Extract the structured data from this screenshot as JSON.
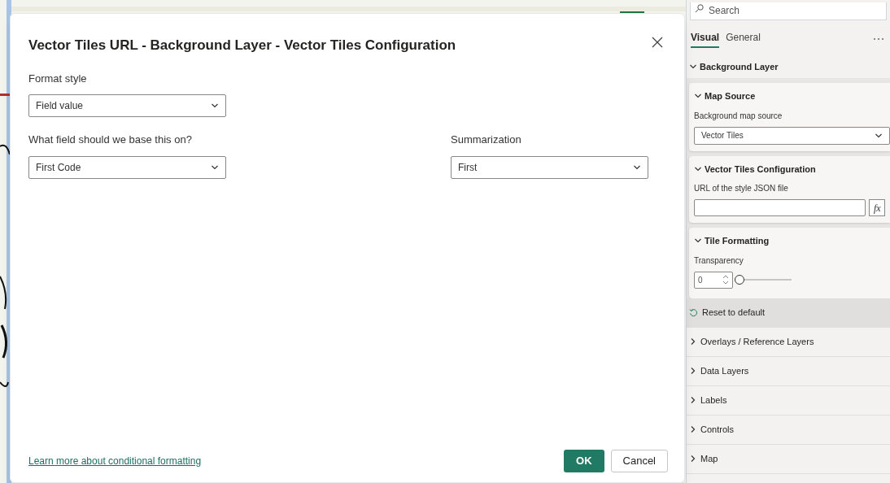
{
  "dialog": {
    "title": "Vector Tiles URL - Background Layer - Vector Tiles Configuration",
    "fields": [
      {
        "label": "Format style",
        "value": "Field value"
      },
      {
        "label": "What field should we base this on?",
        "value": "First Code"
      },
      {
        "label": "Summarization",
        "value": "First"
      }
    ],
    "link": "Learn more about conditional formatting",
    "buttons": [
      {
        "label": "OK",
        "primary": true
      },
      {
        "label": "Cancel",
        "primary": false
      }
    ]
  },
  "pane": {
    "search": {
      "placeholder": "Search"
    },
    "tabs": [
      {
        "label": "Visual",
        "selected": true
      },
      {
        "label": "General",
        "selected": false
      }
    ],
    "section": {
      "title": "Background Layer",
      "expanded": true
    },
    "cards": [
      {
        "kind": "dropdown",
        "title": "Map Source",
        "expanded": true,
        "label": "Background map source",
        "value": "Vector Tiles"
      },
      {
        "kind": "text",
        "title": "Vector Tiles Configuration",
        "expanded": true,
        "label": "URL of the style JSON file",
        "button": "fx"
      },
      {
        "kind": "slider",
        "title": "Tile Formatting",
        "expanded": true,
        "label": "Transparency",
        "value": "0",
        "level": 0
      }
    ],
    "reset": "Reset to default",
    "collapsed": [
      {
        "title": "Overlays / Reference Layers",
        "expanded": false
      },
      {
        "title": "Data Layers",
        "expanded": false
      },
      {
        "title": "Labels",
        "expanded": false
      },
      {
        "title": "Controls",
        "expanded": false
      },
      {
        "title": "Map",
        "expanded": false
      }
    ]
  }
}
